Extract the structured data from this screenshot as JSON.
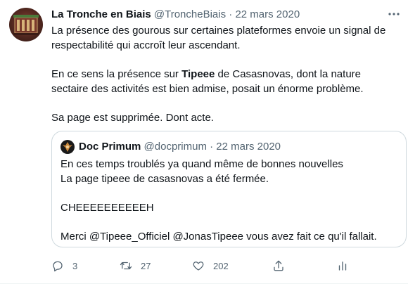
{
  "tweet": {
    "name": "La Tronche en Biais",
    "handle": "@TroncheBiais",
    "separator": "·",
    "date": "22 mars 2020",
    "paragraph1": "La présence des gourous sur certaines plateformes envoie un signal de respectabilité qui accroît leur ascendant.",
    "paragraph2_before": "En ce sens la présence sur ",
    "paragraph2_bold": "Tipeee",
    "paragraph2_after": " de Casasnovas, dont la nature sectaire des activités est bien admise, posait un énorme problème.",
    "paragraph3": "Sa page est supprimée. Dont acte."
  },
  "quote": {
    "name": "Doc Primum",
    "handle": "@docprimum",
    "separator": "·",
    "date": "22 mars 2020",
    "line1": "En ces temps troublés ya quand même de bonnes nouvelles",
    "line2": "La page tipeee de casasnovas a été fermée.",
    "line3": "CHEEEEEEEEEEH",
    "line4": "Merci @Tipeee_Officiel @JonasTipeee vous avez fait ce qu'il fallait."
  },
  "actions": {
    "replies": "3",
    "retweets": "27",
    "likes": "202"
  },
  "icons": {
    "reply": "reply-icon",
    "retweet": "retweet-icon",
    "like": "heart-icon",
    "share": "share-icon",
    "analytics": "analytics-icon",
    "more": "more-icon"
  },
  "colors": {
    "text": "#0f1419",
    "secondary": "#536471",
    "border": "#cfd9de"
  }
}
